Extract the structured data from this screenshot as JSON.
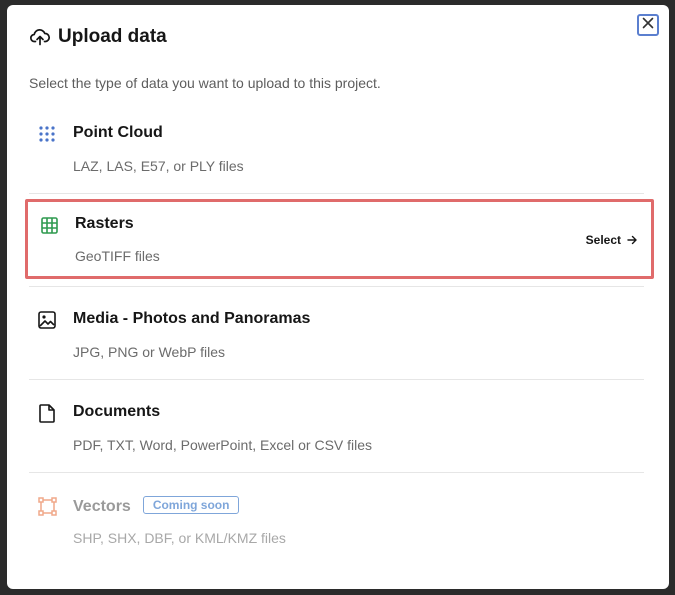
{
  "dialog": {
    "title": "Upload data",
    "subtitle": "Select the type of data you want to upload to this project.",
    "close_icon": "close-icon",
    "title_icon": "cloud-upload-icon"
  },
  "options": [
    {
      "title": "Point Cloud",
      "description": "LAZ, LAS, E57, or PLY files",
      "icon": "dots-grid-icon",
      "icon_color": "#4a74c9"
    },
    {
      "title": "Rasters",
      "description": "GeoTIFF files",
      "icon": "grid-icon",
      "icon_color": "#2e9a4f",
      "action_label": "Select",
      "action_icon": "arrow-right-icon",
      "highlighted": true
    },
    {
      "title": "Media - Photos and Panoramas",
      "description": "JPG, PNG or WebP files",
      "icon": "image-icon",
      "icon_color": "#161616"
    },
    {
      "title": "Documents",
      "description": "PDF, TXT, Word, PowerPoint, Excel or CSV files",
      "icon": "document-icon",
      "icon_color": "#161616"
    },
    {
      "title": "Vectors",
      "description": "SHP, SHX, DBF, or KML/KMZ files",
      "icon": "vector-shape-icon",
      "icon_color": "#f0a98a",
      "badge": "Coming soon",
      "disabled": true
    }
  ],
  "colors": {
    "highlight_border": "#e06b6b",
    "badge": "#7fa6da"
  }
}
